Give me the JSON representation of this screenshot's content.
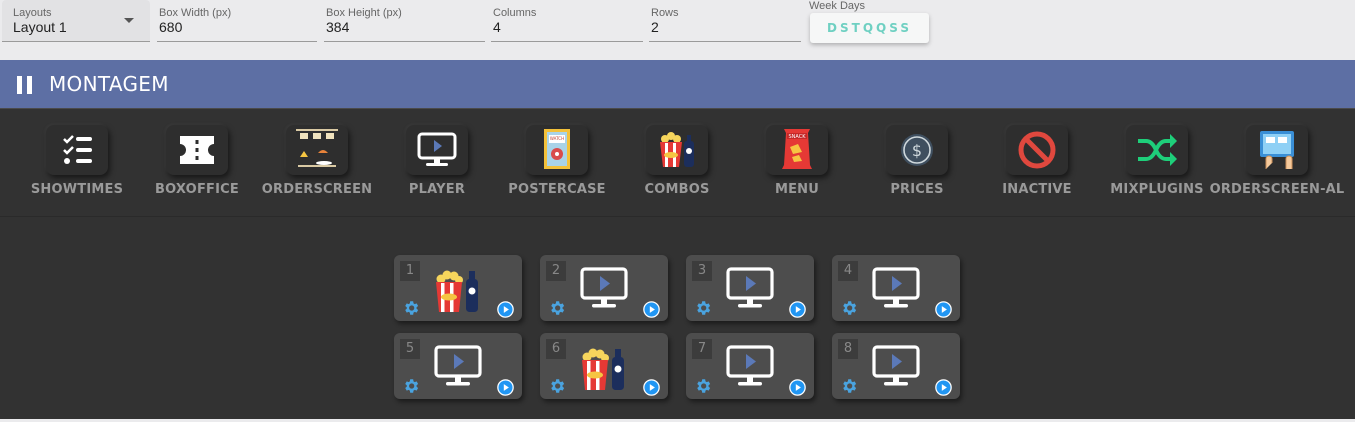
{
  "form": {
    "layouts": {
      "label": "Layouts",
      "value": "Layout 1"
    },
    "box_width": {
      "label": "Box Width (px)",
      "value": "680"
    },
    "box_height": {
      "label": "Box Height (px)",
      "value": "384"
    },
    "columns": {
      "label": "Columns",
      "value": "4"
    },
    "rows": {
      "label": "Rows",
      "value": "2"
    },
    "week_days": {
      "label": "Week Days",
      "value": "DSTQQSS"
    }
  },
  "header": {
    "title": "MONTAGEM",
    "color": "#5d6fa4"
  },
  "plugins": [
    {
      "label": "SHOWTIMES",
      "icon": "checklist-icon"
    },
    {
      "label": "BOXOFFICE",
      "icon": "ticket-icon"
    },
    {
      "label": "ORDERSCREEN",
      "icon": "order-screen-icon"
    },
    {
      "label": "PLAYER",
      "icon": "monitor-play-icon"
    },
    {
      "label": "POSTERCASE",
      "icon": "poster-icon"
    },
    {
      "label": "COMBOS",
      "icon": "popcorn-soda-icon"
    },
    {
      "label": "MENU",
      "icon": "snack-bag-icon"
    },
    {
      "label": "PRICES",
      "icon": "dollar-icon"
    },
    {
      "label": "INACTIVE",
      "icon": "prohibited-icon"
    },
    {
      "label": "MIXPLUGINS",
      "icon": "shuffle-icon"
    },
    {
      "label": "ORDERSCREEN-AL",
      "icon": "touch-screen-icon"
    }
  ],
  "boxes": [
    {
      "number": "1",
      "plugin": "combos"
    },
    {
      "number": "2",
      "plugin": "player"
    },
    {
      "number": "3",
      "plugin": "player"
    },
    {
      "number": "4",
      "plugin": "player"
    },
    {
      "number": "5",
      "plugin": "player"
    },
    {
      "number": "6",
      "plugin": "combos"
    },
    {
      "number": "7",
      "plugin": "player"
    },
    {
      "number": "8",
      "plugin": "player"
    }
  ],
  "colors": {
    "accent_teal": "#6fd0c2",
    "play_blue": "#2196f3",
    "gear_blue": "#4aa3df",
    "background_dark": "#323232"
  }
}
